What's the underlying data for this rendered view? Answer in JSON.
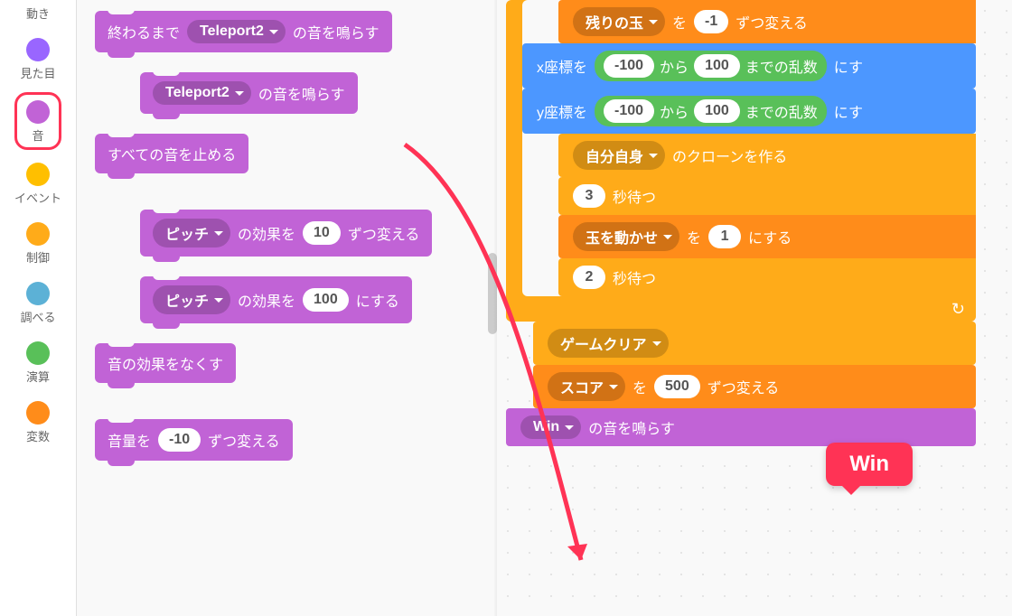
{
  "categories": [
    {
      "label": "動き",
      "color": "#4c97ff"
    },
    {
      "label": "見た目",
      "color": "#9966ff"
    },
    {
      "label": "音",
      "color": "#c163d6",
      "selected": true
    },
    {
      "label": "イベント",
      "color": "#ffbf00"
    },
    {
      "label": "制御",
      "color": "#ffab19"
    },
    {
      "label": "調べる",
      "color": "#5cb1d6"
    },
    {
      "label": "演算",
      "color": "#59c059"
    },
    {
      "label": "変数",
      "color": "#ff8c1a"
    }
  ],
  "palette": {
    "block1": {
      "prefix": "終わるまで",
      "dropdown": "Teleport2",
      "suffix": "の音を鳴らす"
    },
    "block2": {
      "dropdown": "Teleport2",
      "suffix": "の音を鳴らす"
    },
    "block3": {
      "text": "すべての音を止める"
    },
    "block4": {
      "dropdown": "ピッチ",
      "mid": "の効果を",
      "value": "10",
      "suffix": "ずつ変える"
    },
    "block5": {
      "dropdown": "ピッチ",
      "mid": "の効果を",
      "value": "100",
      "suffix": "にする"
    },
    "block6": {
      "text": "音の効果をなくす"
    },
    "block7": {
      "prefix": "音量を",
      "value": "-10",
      "suffix": "ずつ変える"
    }
  },
  "workspace": {
    "row1": {
      "dropdown": "残りの玉",
      "mid": "を",
      "value": "-1",
      "suffix": "ずつ変える"
    },
    "row2": {
      "prefix": "x座標を",
      "lo": "-100",
      "mid": "から",
      "hi": "100",
      "suffix1": "までの乱数",
      "suffix2": "にす"
    },
    "row3": {
      "prefix": "y座標を",
      "lo": "-100",
      "mid": "から",
      "hi": "100",
      "suffix1": "までの乱数",
      "suffix2": "にす"
    },
    "row4": {
      "dropdown": "自分自身",
      "suffix": "のクローンを作る"
    },
    "row5": {
      "value": "3",
      "suffix": "秒待つ"
    },
    "row6": {
      "dropdown": "玉を動かせ",
      "mid": "を",
      "value": "1",
      "suffix": "にする"
    },
    "row7": {
      "value": "2",
      "suffix": "秒待つ"
    },
    "row8": {
      "text": "ゲームクリア"
    },
    "row9": {
      "dropdown": "スコア",
      "mid": "を",
      "value": "500",
      "suffix": "ずつ変える"
    },
    "row10": {
      "dropdown": "Win",
      "suffix": "の音を鳴らす"
    }
  },
  "callout": "Win"
}
